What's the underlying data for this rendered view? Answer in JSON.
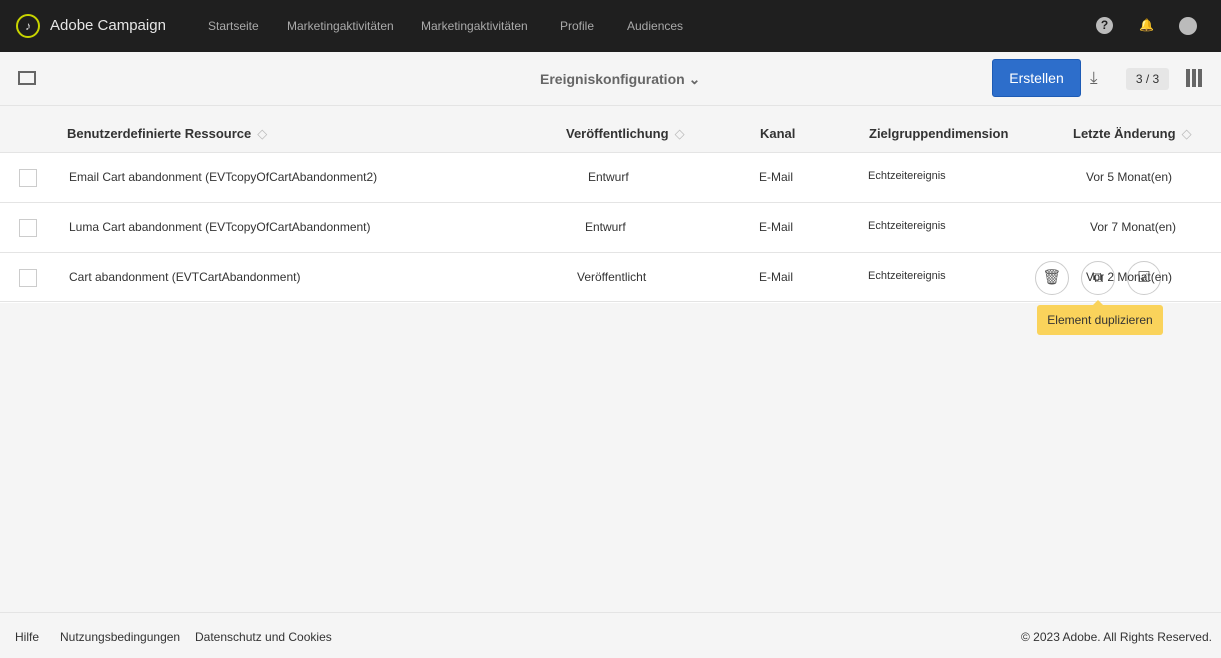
{
  "app": {
    "title": "Adobe Campaign",
    "nav": [
      "Startseite",
      "Marketingaktivitäten",
      "Marketingaktivitäten",
      "Profile",
      "Audiences"
    ]
  },
  "toolbar": {
    "title": "Ereigniskonfiguration",
    "create_label": "Erstellen",
    "count": "3 / 3"
  },
  "table": {
    "headers": [
      "Benutzerdefinierte Ressource",
      "Veröffentlichung",
      "Kanal",
      "Zielgruppendimension",
      "Letzte Änderung"
    ],
    "rows": [
      [
        "Email Cart abandonment (EVTcopyOfCartAbandonment2)",
        "Entwurf",
        "E-Mail",
        "Echtzeitereignis",
        "Vor 5 Monat(en)"
      ],
      [
        "Luma Cart abandonment (EVTcopyOfCartAbandonment)",
        "Entwurf",
        "E-Mail",
        "Echtzeitereignis",
        "Vor 7 Monat(en)"
      ],
      [
        "Cart abandonment (EVTCartAbandonment)",
        "Veröffentlicht",
        "E-Mail",
        "Echtzeitereignis",
        "Vor 2 Monat(en)"
      ]
    ]
  },
  "tooltip": "Element duplizieren",
  "footer": {
    "links": [
      "Hilfe",
      "Nutzungsbedingungen",
      "Datenschutz und Cookies"
    ],
    "copyright": "© 2023 Adobe. All Rights Reserved."
  }
}
